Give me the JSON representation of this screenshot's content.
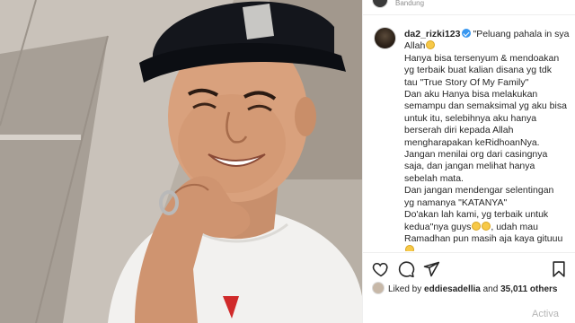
{
  "post": {
    "location": "Bandung",
    "username": "da2_rizki123",
    "caption_lines": [
      "\"Peluang pahala in sya",
      "Allah",
      "Hanya bisa tersenyum & mendoakan",
      "yg terbaik buat kalian disana yg tdk",
      "tau \"True Story Of My Family\"",
      "Dan aku Hanya bisa melakukan",
      "semampu dan semaksimal yg aku bisa",
      "untuk itu, selebihnya aku hanya",
      "berserah diri kepada Allah",
      "mengharapakan keRidhoanNya.",
      "Jangan menilai org dari casingnya",
      "saja, dan jangan melihat hanya",
      "sebelah mata.",
      "Dan jangan mendengar selentingan",
      "yg namanya \"KATANYA\"",
      "Do'akan lah kami, yg terbaik untuk",
      "kedua\"nya guys",
      ", udah mau",
      "Ramadhan pun masih aja kaya gituuu"
    ],
    "likes": {
      "prefix": "Liked by",
      "user": "eddiesadellia",
      "connector": "and",
      "count": "35,011 others"
    }
  },
  "icons": {
    "like": "heart-icon",
    "comment": "comment-icon",
    "share": "share-icon",
    "save": "bookmark-icon",
    "verified": "verified-badge-icon",
    "emoji": "emoji-icon"
  },
  "watermark": "Activa",
  "colors": {
    "verified_blue": "#3897f0",
    "text": "#262626",
    "muted": "#8e8e8e"
  }
}
